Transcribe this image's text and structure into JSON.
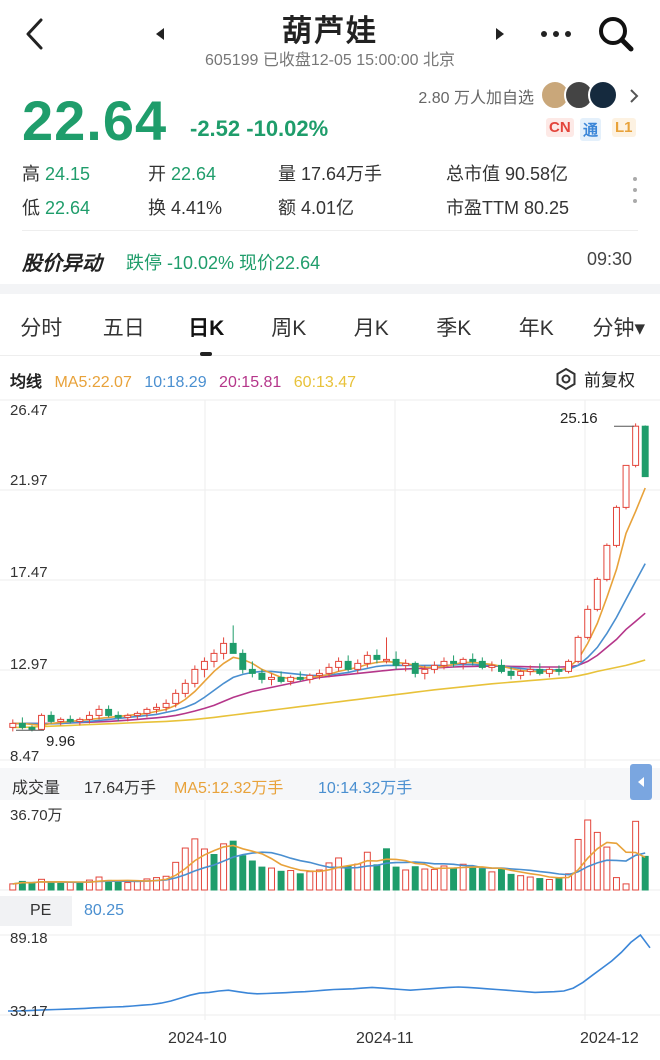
{
  "header": {
    "title": "葫芦娃",
    "subtitle": "605199 已收盘12-05 15:00:00 北京",
    "back_icon": "back-icon",
    "more_icon": "more-icon",
    "search_icon": "search-icon"
  },
  "quote": {
    "price": "22.64",
    "change": "-2.52 -10.02%",
    "watchers": "2.80 万人加自选",
    "tags": [
      "CN",
      "通",
      "L1"
    ],
    "colors": {
      "down": "#1f9d6b",
      "up": "#e3453b"
    }
  },
  "stats": {
    "high_label": "高",
    "high": "24.15",
    "open_label": "开",
    "open": "22.64",
    "volume_label": "量",
    "volume": "17.64万手",
    "mcap_label": "总市值",
    "mcap": "90.58亿",
    "low_label": "低",
    "low": "22.64",
    "turnover_label": "换",
    "turnover": "4.41%",
    "amount_label": "额",
    "amount": "4.01亿",
    "pe_label": "市盈TTM",
    "pe": "80.25"
  },
  "alert": {
    "title": "股价异动",
    "text": "跌停 -10.02% 现价22.64",
    "time": "09:30"
  },
  "tabs": [
    "分时",
    "五日",
    "日K",
    "周K",
    "月K",
    "季K",
    "年K",
    "分钟▾"
  ],
  "active_tab": "日K",
  "ma": {
    "label": "均线",
    "ma5": "MA5:22.07",
    "ma10": "10:18.29",
    "ma20": "20:15.81",
    "ma60": "60:13.47",
    "fq": "前复权",
    "colors": {
      "ma5": "#e8a23a",
      "ma10": "#4a8fd0",
      "ma20": "#b5368a",
      "ma60": "#e8c23a"
    }
  },
  "price_axis": [
    "26.47",
    "21.97",
    "17.47",
    "12.97",
    "8.47"
  ],
  "max_marker": "25.16",
  "min_marker": "9.96",
  "volume": {
    "label": "成交量",
    "current": "17.64万手",
    "ma5": "MA5:12.32万手",
    "ma10": "10:14.32万手",
    "max": "36.70万"
  },
  "pe_panel": {
    "label": "PE",
    "value": "80.25",
    "max": "89.18",
    "min": "33.17"
  },
  "x_axis": [
    "2024-10",
    "2024-11",
    "2024-12"
  ],
  "chart_data": {
    "type": "candlestick",
    "ylim": [
      8.47,
      26.47
    ],
    "candles": [
      [
        10.1,
        10.5,
        9.9,
        10.3
      ],
      [
        10.3,
        10.6,
        10.0,
        10.1
      ],
      [
        10.1,
        10.2,
        9.9,
        10.0
      ],
      [
        10.0,
        10.8,
        9.96,
        10.7
      ],
      [
        10.7,
        10.9,
        10.3,
        10.4
      ],
      [
        10.4,
        10.6,
        10.2,
        10.5
      ],
      [
        10.5,
        10.7,
        10.3,
        10.4
      ],
      [
        10.4,
        10.6,
        10.2,
        10.5
      ],
      [
        10.5,
        10.9,
        10.3,
        10.7
      ],
      [
        10.7,
        11.2,
        10.5,
        11.0
      ],
      [
        11.0,
        11.2,
        10.6,
        10.7
      ],
      [
        10.7,
        10.9,
        10.4,
        10.6
      ],
      [
        10.6,
        10.8,
        10.4,
        10.7
      ],
      [
        10.7,
        10.9,
        10.5,
        10.8
      ],
      [
        10.8,
        11.1,
        10.6,
        11.0
      ],
      [
        11.0,
        11.3,
        10.8,
        11.1
      ],
      [
        11.1,
        11.5,
        10.9,
        11.3
      ],
      [
        11.3,
        12.0,
        11.1,
        11.8
      ],
      [
        11.8,
        12.5,
        11.6,
        12.3
      ],
      [
        12.3,
        13.2,
        12.1,
        13.0
      ],
      [
        13.0,
        13.6,
        12.6,
        13.4
      ],
      [
        13.4,
        14.0,
        13.1,
        13.8
      ],
      [
        13.8,
        14.6,
        13.5,
        14.3
      ],
      [
        14.3,
        15.2,
        14.1,
        13.8
      ],
      [
        13.8,
        14.0,
        12.8,
        13.0
      ],
      [
        13.0,
        13.4,
        12.6,
        12.8
      ],
      [
        12.8,
        13.0,
        12.3,
        12.5
      ],
      [
        12.5,
        12.8,
        12.2,
        12.6
      ],
      [
        12.6,
        12.9,
        12.3,
        12.4
      ],
      [
        12.4,
        12.7,
        12.2,
        12.6
      ],
      [
        12.6,
        12.9,
        12.4,
        12.5
      ],
      [
        12.5,
        12.8,
        12.3,
        12.7
      ],
      [
        12.7,
        13.0,
        12.5,
        12.8
      ],
      [
        12.8,
        13.3,
        12.6,
        13.1
      ],
      [
        13.1,
        13.6,
        12.9,
        13.4
      ],
      [
        13.4,
        13.7,
        12.9,
        13.0
      ],
      [
        13.0,
        13.5,
        12.8,
        13.3
      ],
      [
        13.3,
        13.9,
        13.1,
        13.7
      ],
      [
        13.7,
        14.0,
        13.3,
        13.5
      ],
      [
        13.5,
        14.6,
        13.3,
        13.5
      ],
      [
        13.5,
        13.9,
        13.0,
        13.2
      ],
      [
        13.2,
        13.5,
        12.9,
        13.3
      ],
      [
        13.3,
        13.4,
        12.6,
        12.8
      ],
      [
        12.8,
        13.2,
        12.5,
        13.0
      ],
      [
        13.0,
        13.4,
        12.8,
        13.2
      ],
      [
        13.2,
        13.6,
        13.0,
        13.4
      ],
      [
        13.4,
        13.7,
        13.1,
        13.3
      ],
      [
        13.3,
        13.6,
        13.0,
        13.5
      ],
      [
        13.5,
        13.8,
        13.2,
        13.4
      ],
      [
        13.4,
        13.6,
        13.0,
        13.1
      ],
      [
        13.1,
        13.4,
        12.9,
        13.2
      ],
      [
        13.2,
        13.5,
        12.8,
        12.9
      ],
      [
        12.9,
        13.1,
        12.5,
        12.7
      ],
      [
        12.7,
        13.0,
        12.5,
        12.9
      ],
      [
        12.9,
        13.2,
        12.7,
        13.0
      ],
      [
        13.0,
        13.3,
        12.7,
        12.8
      ],
      [
        12.8,
        13.1,
        12.6,
        13.0
      ],
      [
        13.0,
        13.2,
        12.7,
        12.9
      ],
      [
        12.9,
        13.5,
        12.8,
        13.4
      ],
      [
        13.4,
        14.7,
        13.3,
        14.6
      ],
      [
        14.6,
        16.2,
        14.5,
        16.0
      ],
      [
        16.0,
        17.6,
        15.9,
        17.5
      ],
      [
        17.5,
        19.3,
        17.4,
        19.2
      ],
      [
        19.2,
        21.2,
        19.1,
        21.1
      ],
      [
        21.1,
        23.2,
        21.0,
        23.2
      ],
      [
        23.2,
        25.3,
        23.1,
        25.16
      ],
      [
        25.16,
        25.2,
        22.64,
        22.64
      ]
    ],
    "volumes": [
      [
        3.2,
        1
      ],
      [
        4.5,
        0
      ],
      [
        3.8,
        0
      ],
      [
        5.6,
        1
      ],
      [
        4.2,
        0
      ],
      [
        3.5,
        0
      ],
      [
        4.0,
        1
      ],
      [
        3.6,
        0
      ],
      [
        5.2,
        1
      ],
      [
        6.8,
        1
      ],
      [
        5.0,
        0
      ],
      [
        4.2,
        0
      ],
      [
        3.9,
        1
      ],
      [
        4.5,
        1
      ],
      [
        5.8,
        1
      ],
      [
        6.5,
        1
      ],
      [
        7.2,
        1
      ],
      [
        14.5,
        1
      ],
      [
        22.0,
        1
      ],
      [
        26.8,
        1
      ],
      [
        21.5,
        1
      ],
      [
        18.6,
        0
      ],
      [
        24.2,
        1
      ],
      [
        25.6,
        0
      ],
      [
        18.0,
        0
      ],
      [
        15.2,
        0
      ],
      [
        12.0,
        0
      ],
      [
        11.5,
        1
      ],
      [
        9.8,
        0
      ],
      [
        10.2,
        1
      ],
      [
        8.5,
        0
      ],
      [
        9.6,
        1
      ],
      [
        10.5,
        1
      ],
      [
        14.2,
        1
      ],
      [
        16.8,
        1
      ],
      [
        12.5,
        0
      ],
      [
        13.6,
        1
      ],
      [
        19.8,
        1
      ],
      [
        13.2,
        0
      ],
      [
        21.6,
        0
      ],
      [
        12.0,
        0
      ],
      [
        10.5,
        1
      ],
      [
        12.2,
        0
      ],
      [
        11.0,
        1
      ],
      [
        10.8,
        1
      ],
      [
        12.6,
        1
      ],
      [
        11.2,
        0
      ],
      [
        13.5,
        1
      ],
      [
        12.0,
        0
      ],
      [
        11.2,
        0
      ],
      [
        9.5,
        1
      ],
      [
        10.8,
        0
      ],
      [
        8.2,
        0
      ],
      [
        7.5,
        1
      ],
      [
        6.8,
        1
      ],
      [
        6.0,
        0
      ],
      [
        5.5,
        1
      ],
      [
        6.2,
        0
      ],
      [
        8.5,
        1
      ],
      [
        26.5,
        1
      ],
      [
        36.7,
        1
      ],
      [
        30.2,
        1
      ],
      [
        22.5,
        1
      ],
      [
        6.5,
        1
      ],
      [
        3.2,
        1
      ],
      [
        36.0,
        1
      ],
      [
        17.64,
        0
      ]
    ],
    "ma5": [
      10.3,
      10.3,
      10.25,
      10.2,
      10.3,
      10.35,
      10.4,
      10.45,
      10.5,
      10.55,
      10.6,
      10.65,
      10.7,
      10.75,
      10.8,
      10.9,
      11.0,
      11.2,
      11.5,
      11.9,
      12.4,
      12.9,
      13.3,
      13.6,
      13.5,
      13.3,
      13.0,
      12.8,
      12.6,
      12.55,
      12.55,
      12.6,
      12.65,
      12.75,
      12.9,
      13.0,
      13.1,
      13.25,
      13.35,
      13.4,
      13.35,
      13.3,
      13.2,
      13.1,
      13.1,
      13.15,
      13.25,
      13.35,
      13.35,
      13.3,
      13.25,
      13.15,
      13.05,
      12.95,
      12.9,
      12.9,
      12.9,
      12.95,
      13.1,
      13.5,
      14.3,
      15.3,
      16.6,
      18.0,
      19.8,
      20.9,
      22.07
    ],
    "ma10": [
      10.3,
      10.3,
      10.3,
      10.28,
      10.28,
      10.3,
      10.33,
      10.36,
      10.4,
      10.45,
      10.5,
      10.55,
      10.6,
      10.65,
      10.7,
      10.75,
      10.85,
      10.95,
      11.1,
      11.3,
      11.6,
      11.95,
      12.3,
      12.6,
      12.75,
      12.85,
      12.9,
      12.9,
      12.85,
      12.8,
      12.75,
      12.7,
      12.7,
      12.72,
      12.78,
      12.85,
      12.95,
      13.05,
      13.15,
      13.2,
      13.2,
      13.2,
      13.2,
      13.2,
      13.2,
      13.2,
      13.22,
      13.25,
      13.25,
      13.22,
      13.2,
      13.15,
      13.1,
      13.05,
      13.0,
      12.98,
      12.97,
      12.98,
      13.0,
      13.2,
      13.6,
      14.1,
      14.8,
      15.6,
      16.5,
      17.4,
      18.29
    ],
    "ma20": [
      10.3,
      10.3,
      10.3,
      10.3,
      10.3,
      10.3,
      10.32,
      10.34,
      10.36,
      10.38,
      10.4,
      10.43,
      10.46,
      10.5,
      10.54,
      10.58,
      10.63,
      10.7,
      10.8,
      10.92,
      11.05,
      11.2,
      11.4,
      11.6,
      11.75,
      11.9,
      12.0,
      12.1,
      12.2,
      12.3,
      12.4,
      12.5,
      12.6,
      12.65,
      12.7,
      12.75,
      12.8,
      12.85,
      12.9,
      12.95,
      13.0,
      13.02,
      13.04,
      13.06,
      13.08,
      13.1,
      13.12,
      13.14,
      13.15,
      13.16,
      13.16,
      13.16,
      13.15,
      13.14,
      13.13,
      13.12,
      13.12,
      13.12,
      13.13,
      13.2,
      13.4,
      13.7,
      14.1,
      14.5,
      15.0,
      15.4,
      15.81
    ],
    "ma60": [
      10.1,
      10.1,
      10.12,
      10.14,
      10.16,
      10.18,
      10.2,
      10.22,
      10.24,
      10.26,
      10.28,
      10.3,
      10.32,
      10.34,
      10.36,
      10.38,
      10.4,
      10.43,
      10.46,
      10.5,
      10.55,
      10.6,
      10.66,
      10.72,
      10.78,
      10.84,
      10.9,
      10.96,
      11.02,
      11.08,
      11.14,
      11.2,
      11.26,
      11.32,
      11.38,
      11.44,
      11.5,
      11.56,
      11.62,
      11.68,
      11.74,
      11.8,
      11.86,
      11.92,
      11.98,
      12.03,
      12.08,
      12.13,
      12.18,
      12.23,
      12.28,
      12.32,
      12.36,
      12.4,
      12.44,
      12.48,
      12.52,
      12.56,
      12.6,
      12.68,
      12.78,
      12.9,
      13.0,
      13.1,
      13.2,
      13.33,
      13.47
    ],
    "pe": [
      36,
      36,
      36.2,
      36.5,
      36.8,
      37,
      37.2,
      37.5,
      37.8,
      38.2,
      38.5,
      38.8,
      39,
      39.5,
      40,
      40.5,
      41.5,
      43,
      45,
      47,
      48.5,
      49,
      50,
      50.5,
      49.5,
      48.5,
      48,
      48.2,
      48.5,
      48.8,
      49.2,
      49.5,
      50,
      50.5,
      51,
      51.2,
      51.5,
      52,
      52.5,
      52,
      51.5,
      51,
      50.5,
      51,
      51.5,
      52,
      52.5,
      52.8,
      52.5,
      52,
      51.5,
      51,
      50.5,
      50,
      49.5,
      49,
      49.2,
      49.5,
      50,
      52,
      56,
      61,
      66,
      71,
      77,
      84,
      89.18,
      80.25
    ]
  }
}
